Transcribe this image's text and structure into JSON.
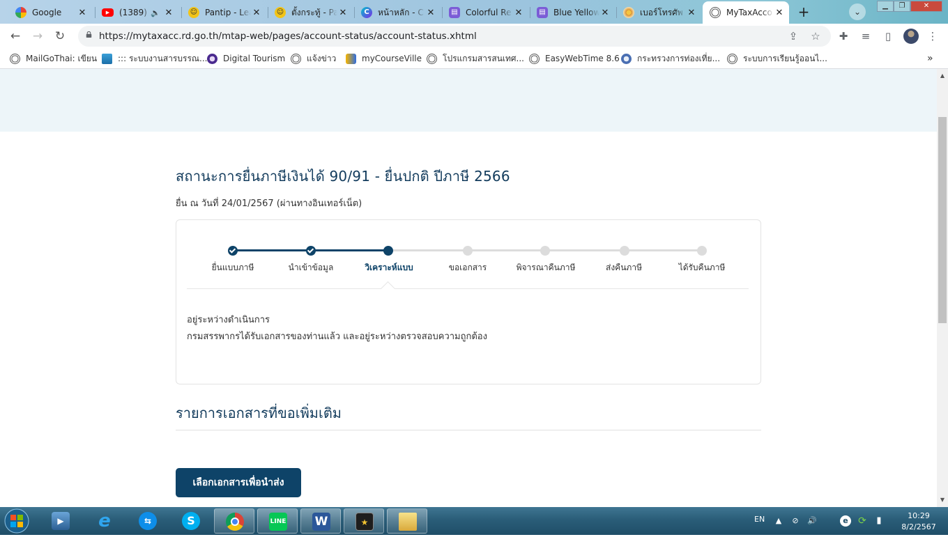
{
  "browser": {
    "tabs": [
      {
        "title": "Google",
        "icon": "google-icon"
      },
      {
        "title": "(1389)",
        "icon": "youtube-icon",
        "audio": "speaker-icon"
      },
      {
        "title": "Pantip - Lea",
        "icon": "pantip-icon"
      },
      {
        "title": "ตั้งกระทู้ - Pa",
        "icon": "pantip-icon"
      },
      {
        "title": "หน้าหลัก - C",
        "icon": "canva-icon"
      },
      {
        "title": "Colorful Re",
        "icon": "print-icon"
      },
      {
        "title": "Blue Yellow",
        "icon": "print-icon"
      },
      {
        "title": "เบอร์โทรศัพ",
        "icon": "site-icon"
      },
      {
        "title": "MyTaxAcco",
        "icon": "globe-icon",
        "active": true
      }
    ],
    "url": "https://mytaxacc.rd.go.th/mtap-web/pages/account-status/account-status.xhtml",
    "bookmarks": [
      {
        "label": "MailGoThai: เขียน",
        "icon": "globe-icon"
      },
      {
        "label": "::: ระบบงานสารบรรณ...",
        "icon": "monitor-icon"
      },
      {
        "label": "Digital Tourism",
        "icon": "emblem-icon"
      },
      {
        "label": "แจ้งข่าว",
        "icon": "globe-icon"
      },
      {
        "label": "myCourseVille",
        "icon": "courseville-icon"
      },
      {
        "label": "โปรแกรมสารสนเทศ...",
        "icon": "globe-icon"
      },
      {
        "label": "EasyWebTime 8.6",
        "icon": "globe-icon"
      },
      {
        "label": "กระทรวงการท่องเที่ย...",
        "icon": "emblem-icon"
      },
      {
        "label": "ระบบการเรียนรู้ออนไ...",
        "icon": "globe-icon"
      }
    ],
    "more_bookmarks": "»"
  },
  "page": {
    "title": "สถานะการยื่นภาษีเงินได้ 90/91 - ยื่นปกติ ปีภาษี 2566",
    "subtitle": "ยื่น ณ วันที่ 24/01/2567 (ผ่านทางอินเทอร์เน็ต)",
    "steps": [
      {
        "label": "ยื่นแบบภาษี",
        "state": "done"
      },
      {
        "label": "นำเข้าข้อมูล",
        "state": "done"
      },
      {
        "label": "วิเคราะห์แบบ",
        "state": "current"
      },
      {
        "label": "ขอเอกสาร",
        "state": "pending"
      },
      {
        "label": "พิจารณาคืนภาษี",
        "state": "pending"
      },
      {
        "label": "ส่งคืนภาษี",
        "state": "pending"
      },
      {
        "label": "ได้รับคืนภาษี",
        "state": "pending"
      }
    ],
    "status_title": "อยู่ระหว่างดำเนินการ",
    "status_desc": "กรมสรรพากรได้รับเอกสารของท่านแล้ว และอยู่ระหว่างตรวจสอบความถูกต้อง",
    "docs_heading": "รายการเอกสารที่ขอเพิ่มเติม",
    "choose_button": "เลือกเอกสารเพื่อนำส่ง"
  },
  "taskbar": {
    "apps": [
      "media-player-icon",
      "internet-explorer-icon",
      "teamviewer-icon",
      "skype-icon",
      "chrome-icon",
      "line-icon",
      "word-icon",
      "movie-maker-icon",
      "file-explorer-icon"
    ],
    "language": "EN",
    "time": "10:29",
    "date": "8/2/2567"
  },
  "colors": {
    "primary": "#0e4368",
    "hero_bg": "#edf5f9",
    "pending": "#dcdcdc"
  }
}
